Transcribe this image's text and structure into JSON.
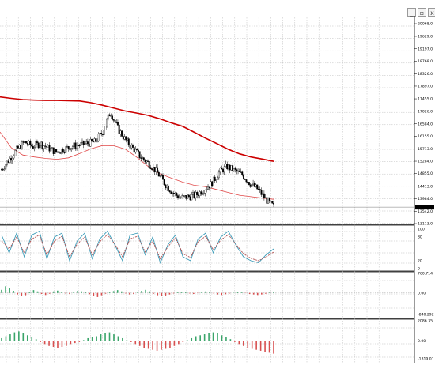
{
  "window": {
    "buttons": [
      "_",
      "▫",
      "x"
    ]
  },
  "chart_data": [
    {
      "type": "candlestick",
      "panel": "price",
      "y_ticks": [
        "20068.0",
        "19629.0",
        "19197.0",
        "18768.0",
        "18326.0",
        "17897.0",
        "17455.0",
        "17026.0",
        "16584.0",
        "16155.0",
        "15713.0",
        "15284.0",
        "14855.0",
        "14413.0",
        "13984.0",
        "13542.0",
        "13113.0"
      ],
      "ylim": [
        13113.0,
        20068.0
      ],
      "last_price_label": "13687.0",
      "series": [
        {
          "name": "",
          "color": "#cc0000",
          "values": [
            17520,
            17470,
            17430,
            17410,
            17400,
            17400,
            17390,
            17380,
            17320,
            17230,
            17130,
            17030,
            16960,
            16880,
            16760,
            16620,
            16500,
            16300,
            16090,
            15900,
            15700,
            15540,
            15430,
            15360,
            15280
          ]
        },
        {
          "name": "",
          "color": "#e04848",
          "values": [
            16300,
            15750,
            15500,
            15430,
            15380,
            15350,
            15400,
            15550,
            15720,
            15830,
            15820,
            15700,
            15420,
            15100,
            14850,
            14700,
            14560,
            14450,
            14400,
            14300,
            14200,
            14100,
            14050,
            14000,
            13960
          ]
        }
      ],
      "close": [
        15000,
        15350,
        15700,
        15950,
        15800,
        15900,
        15750,
        15600,
        15700,
        15800,
        15850,
        15900,
        15950,
        16300,
        17000,
        16400,
        16000,
        15700,
        15400,
        15200,
        14900,
        14500,
        14200,
        14000,
        14050,
        14100,
        14300,
        14500,
        14900,
        15100,
        14950,
        14800,
        14500,
        14300,
        13950,
        13700
      ]
    },
    {
      "type": "line",
      "panel": "stochastic",
      "y_ticks": [
        "100",
        "80",
        "20",
        "0"
      ],
      "ylim": [
        0,
        100
      ],
      "series": [
        {
          "name": "",
          "color": "#3a9bb8",
          "values": [
            85,
            40,
            90,
            30,
            85,
            95,
            25,
            80,
            90,
            20,
            70,
            90,
            25,
            75,
            95,
            60,
            20,
            85,
            90,
            35,
            80,
            15,
            60,
            85,
            30,
            20,
            75,
            90,
            40,
            80,
            95,
            60,
            30,
            20,
            15,
            35,
            50
          ]
        },
        {
          "name": "",
          "color": "#b05050",
          "values": [
            70,
            50,
            80,
            40,
            75,
            85,
            35,
            70,
            82,
            30,
            62,
            80,
            35,
            68,
            86,
            62,
            30,
            75,
            82,
            42,
            70,
            25,
            55,
            78,
            38,
            28,
            68,
            82,
            48,
            72,
            86,
            62,
            38,
            26,
            20,
            30,
            42
          ]
        }
      ]
    },
    {
      "type": "bar",
      "panel": "oscillator_1",
      "y_ticks": [
        "760.714",
        "0.00",
        "-840.292"
      ],
      "ylim": [
        -840.292,
        760.714
      ],
      "values": [
        120,
        260,
        200,
        80,
        -60,
        -120,
        -90,
        40,
        110,
        60,
        -40,
        -80,
        -30,
        60,
        90,
        30,
        -20,
        -40,
        30,
        80,
        60,
        20,
        -50,
        -130,
        -160,
        -90,
        -30,
        20,
        70,
        110,
        60,
        -20,
        -60,
        -40,
        30,
        80,
        120,
        60,
        -30,
        -90,
        -120,
        -100,
        -60,
        -20,
        30,
        50,
        20,
        -20,
        -40,
        -10,
        30,
        60,
        40,
        -20,
        -60,
        -80,
        -50,
        -20,
        10,
        40,
        30,
        -10,
        -40,
        -60,
        -80,
        -60,
        -30,
        20,
        40
      ]
    },
    {
      "type": "bar",
      "panel": "oscillator_2",
      "y_ticks": [
        "2086.35",
        "0.00",
        "-1819.01"
      ],
      "ylim": [
        -1819.01,
        2086.35
      ],
      "values": [
        300,
        500,
        700,
        900,
        1000,
        800,
        600,
        400,
        200,
        -100,
        -300,
        -500,
        -600,
        -700,
        -600,
        -500,
        -300,
        -200,
        -100,
        100,
        300,
        400,
        500,
        700,
        800,
        900,
        700,
        500,
        300,
        100,
        -100,
        -300,
        -500,
        -700,
        -800,
        -900,
        -1000,
        -900,
        -800,
        -700,
        -500,
        -300,
        -100,
        100,
        300,
        500,
        600,
        700,
        800,
        900,
        800,
        600,
        400,
        200,
        -100,
        -300,
        -500,
        -700,
        -800,
        -900,
        -1000,
        -1100,
        -1200,
        -1300
      ]
    }
  ]
}
